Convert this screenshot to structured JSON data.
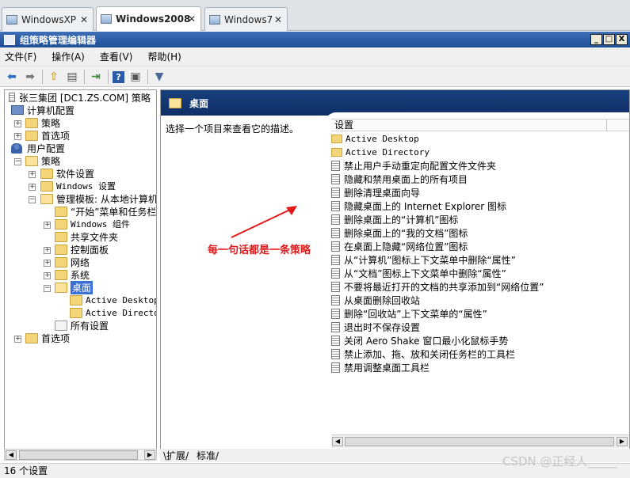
{
  "vm_tabs": [
    {
      "label": "WindowsXP"
    },
    {
      "label": "Windows2008"
    },
    {
      "label": "Windows7"
    }
  ],
  "window": {
    "title": "组策略管理编辑器",
    "btn_min": "_",
    "btn_max": "□",
    "btn_close": "X"
  },
  "menu": [
    "文件(F)",
    "操作(A)",
    "查看(V)",
    "帮助(H)"
  ],
  "tree": {
    "root": "张三集团 [DC1.ZS.COM] 策略",
    "computer": "计算机配置",
    "c_policies": "策略",
    "c_prefs": "首选项",
    "user": "用户配置",
    "u_policies": "策略",
    "software": "软件设置",
    "winsettings": "Windows 设置",
    "admtpl": "管理模板: 从本地计算机",
    "startmenu": "“开始”菜单和任务栏",
    "wincomp": "Windows 组件",
    "shared": "共享文件夹",
    "ctrlpanel": "控制面板",
    "network": "网络",
    "system": "系统",
    "desktop": "桌面",
    "ad_desktop": "Active Desktop",
    "ad_directory": "Active Directory",
    "allsettings": "所有设置",
    "u_prefs": "首选项"
  },
  "right": {
    "header": "桌面",
    "description": "选择一个项目来查看它的描述。",
    "column": "设置",
    "items": [
      "Active Desktop",
      "Active Directory",
      "禁止用户手动重定向配置文件文件夹",
      "隐藏和禁用桌面上的所有项目",
      "删除清理桌面向导",
      "隐藏桌面上的 Internet Explorer 图标",
      "删除桌面上的“计算机”图标",
      "删除桌面上的“我的文档”图标",
      "在桌面上隐藏“网络位置”图标",
      "从“计算机”图标上下文菜单中删除“属性”",
      "从“文档”图标上下文菜单中删除“属性”",
      "不要将最近打开的文档的共享添加到“网络位置”",
      "从桌面删除回收站",
      "删除“回收站”上下文菜单的“属性”",
      "退出时不保存设置",
      "关闭 Aero Shake 窗口最小化鼠标手势",
      "禁止添加、拖、放和关闭任务栏的工具栏",
      "禁用调整桌面工具栏"
    ]
  },
  "bottom_tabs": [
    "扩展",
    "标准"
  ],
  "status": "16 个设置",
  "annotation": "每一句话都是一条策略",
  "watermark": "CSDN @正经人_____",
  "colors": {
    "titlebar": "#1e4f96",
    "header": "#0f2f66",
    "annotation": "#e01818"
  }
}
